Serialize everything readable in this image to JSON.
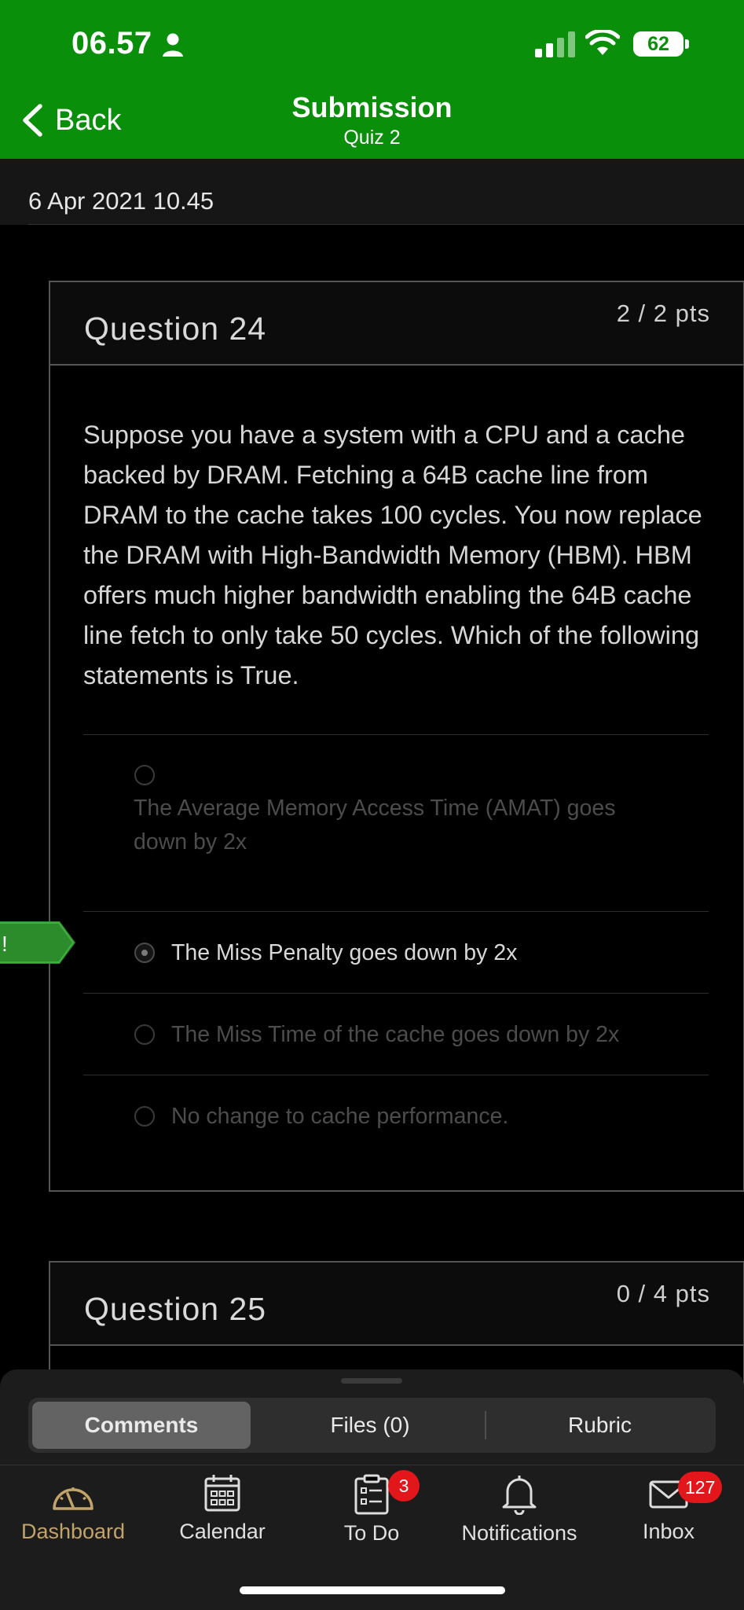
{
  "status": {
    "time": "06.57",
    "battery": "62"
  },
  "nav": {
    "back_label": "Back",
    "title": "Submission",
    "subtitle": "Quiz 2"
  },
  "submission": {
    "date": "6 Apr 2021 10.45"
  },
  "questions": [
    {
      "title": "Question 24",
      "points": "2 / 2 pts",
      "text": "Suppose you have a system with a CPU and a cache backed by DRAM. Fetching a 64B cache line from DRAM to the cache takes 100 cycles. You now replace the DRAM with High-Bandwidth Memory (HBM). HBM offers much higher bandwidth enabling the 64B cache line fetch to only take 50 cycles. Which of the following statements is True.",
      "options": [
        {
          "label": "The Average Memory Access Time (AMAT) goes down by 2x",
          "selected": false
        },
        {
          "label": "The Miss Penalty goes down by 2x",
          "selected": true
        },
        {
          "label": "The Miss Time of the cache goes down by 2x",
          "selected": false
        },
        {
          "label": "No change to cache performance.",
          "selected": false
        }
      ],
      "flag_text": "!"
    },
    {
      "title": "Question 25",
      "points": "0 / 4 pts"
    }
  ],
  "sheet_tabs": [
    {
      "label": "Comments",
      "active": true
    },
    {
      "label": "Files (0)",
      "active": false
    },
    {
      "label": "Rubric",
      "active": false
    }
  ],
  "tab_bar": [
    {
      "label": "Dashboard",
      "icon": "dashboard-icon",
      "active": true
    },
    {
      "label": "Calendar",
      "icon": "calendar-icon",
      "active": false
    },
    {
      "label": "To Do",
      "icon": "todo-icon",
      "badge": "3",
      "active": false
    },
    {
      "label": "Notifications",
      "icon": "bell-icon",
      "active": false
    },
    {
      "label": "Inbox",
      "icon": "mail-icon",
      "badge": "127",
      "active": false
    }
  ],
  "colors": {
    "brand_green": "#0a8f0b",
    "active_tab": "#c2a46a",
    "badge_red": "#e3161b"
  }
}
